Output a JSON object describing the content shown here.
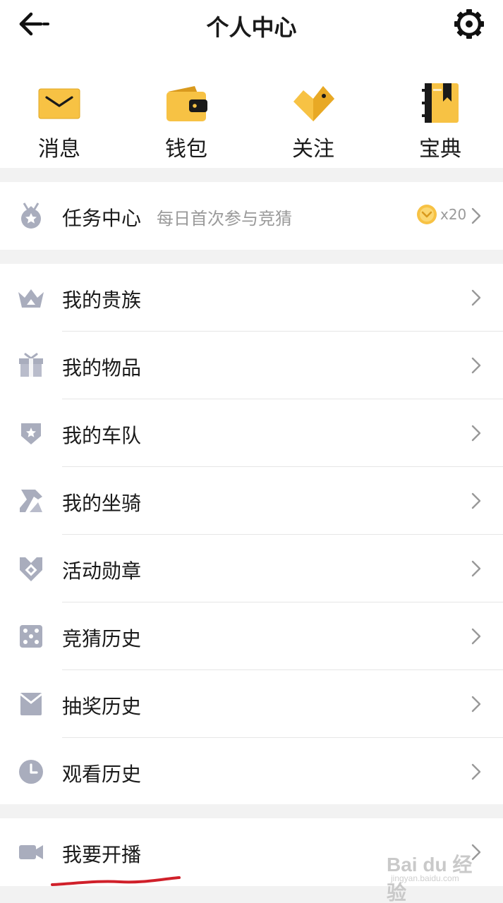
{
  "header": {
    "title": "个人中心",
    "back_icon": "back-arrow-icon",
    "settings_icon": "gear-icon"
  },
  "quick_actions": [
    {
      "label": "消息",
      "icon": "envelope-icon"
    },
    {
      "label": "钱包",
      "icon": "wallet-icon"
    },
    {
      "label": "关注",
      "icon": "heart-tag-icon"
    },
    {
      "label": "宝典",
      "icon": "notebook-icon"
    }
  ],
  "task_center": {
    "label": "任务中心",
    "subtitle": "每日首次参与竞猜",
    "reward_icon": "coin-icon",
    "reward_count": "x20"
  },
  "menu": [
    {
      "label": "我的贵族",
      "icon": "crown-icon"
    },
    {
      "label": "我的物品",
      "icon": "giftbox-icon"
    },
    {
      "label": "我的车队",
      "icon": "shield-star-icon"
    },
    {
      "label": "我的坐骑",
      "icon": "horse-icon"
    },
    {
      "label": "活动勋章",
      "icon": "medal-icon"
    },
    {
      "label": "竞猜历史",
      "icon": "dice-icon"
    },
    {
      "label": "抽奖历史",
      "icon": "red-envelope-icon"
    },
    {
      "label": "观看历史",
      "icon": "clock-icon"
    }
  ],
  "broadcast": {
    "label": "我要开播",
    "icon": "camera-icon"
  },
  "watermark": {
    "text": "Bai du 经验",
    "sub": "jingyan.baidu.com"
  },
  "colors": {
    "accent": "#f5b82e",
    "icon_gray": "#a9adbd",
    "annotation": "#d0202a"
  }
}
